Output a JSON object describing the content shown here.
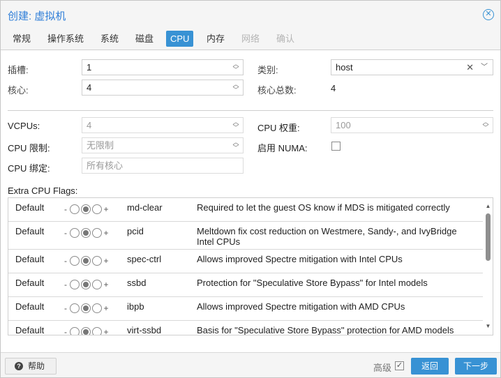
{
  "dialog": {
    "title": "创建: 虚拟机",
    "close_icon": "close-circle-icon"
  },
  "tabs": [
    {
      "label": "常规",
      "state": "normal"
    },
    {
      "label": "操作系统",
      "state": "normal"
    },
    {
      "label": "系统",
      "state": "normal"
    },
    {
      "label": "磁盘",
      "state": "normal"
    },
    {
      "label": "CPU",
      "state": "active"
    },
    {
      "label": "内存",
      "state": "normal"
    },
    {
      "label": "网络",
      "state": "disabled"
    },
    {
      "label": "确认",
      "state": "disabled"
    }
  ],
  "form": {
    "sockets_label": "插槽:",
    "sockets_value": "1",
    "cores_label": "核心:",
    "cores_value": "4",
    "type_label": "类别:",
    "type_value": "host",
    "total_cores_label": "核心总数:",
    "total_cores_value": "4",
    "vcpus_label": "VCPUs:",
    "vcpus_value": "4",
    "cpu_weight_label": "CPU 权重:",
    "cpu_weight_value": "100",
    "cpu_limit_label": "CPU 限制:",
    "cpu_limit_value": "无限制",
    "numa_label": "启用 NUMA:",
    "numa_checked": false,
    "cpu_affinity_label": "CPU 绑定:",
    "cpu_affinity_placeholder": "所有核心"
  },
  "flags": {
    "label": "Extra CPU Flags:",
    "minus": "-",
    "plus": "+",
    "rows": [
      {
        "state": "Default",
        "name": "md-clear",
        "description": "Required to let the guest OS know if MDS is mitigated correctly"
      },
      {
        "state": "Default",
        "name": "pcid",
        "description": "Meltdown fix cost reduction on Westmere, Sandy-, and IvyBridge Intel CPUs"
      },
      {
        "state": "Default",
        "name": "spec-ctrl",
        "description": "Allows improved Spectre mitigation with Intel CPUs"
      },
      {
        "state": "Default",
        "name": "ssbd",
        "description": "Protection for \"Speculative Store Bypass\" for Intel models"
      },
      {
        "state": "Default",
        "name": "ibpb",
        "description": "Allows improved Spectre mitigation with AMD CPUs"
      },
      {
        "state": "Default",
        "name": "virt-ssbd",
        "description": "Basis for \"Speculative Store Bypass\" protection for AMD models"
      }
    ]
  },
  "footer": {
    "help_label": "帮助",
    "advanced_label": "高级",
    "advanced_checked": true,
    "back_label": "返回",
    "next_label": "下一步"
  },
  "colors": {
    "accent": "#3892d4",
    "title": "#2f7ed8"
  }
}
